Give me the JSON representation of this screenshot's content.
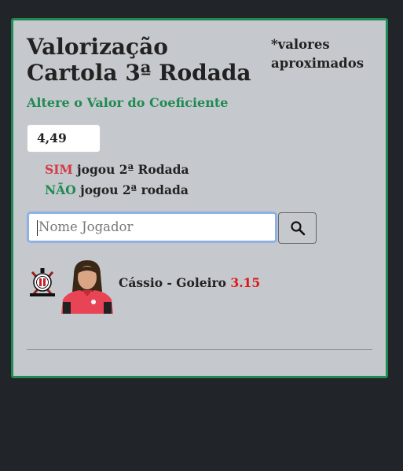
{
  "header": {
    "title": "Valorização Cartola 3ª Rodada",
    "note": "*valores aproximados"
  },
  "coefficient": {
    "link_label": "Altere o Valor do Coeficiente",
    "value": "4,49"
  },
  "legend": {
    "sim_word": "SIM",
    "sim_text": " jogou 2ª Rodada",
    "nao_word": "NÃO",
    "nao_text": " jogou 2ª rodada",
    "sim_color": "#d33b45",
    "nao_color": "#1f8a52"
  },
  "search": {
    "placeholder": "Nome Jogador",
    "icon": "search-icon"
  },
  "players": [
    {
      "club_icon": "corinthians-crest-icon",
      "name_position": "Cássio - Goleiro",
      "value": "3.15",
      "value_color": "#e01616"
    }
  ],
  "colors": {
    "background": "#212428",
    "card": "#c5c8cc",
    "accent": "#1f8a52"
  }
}
